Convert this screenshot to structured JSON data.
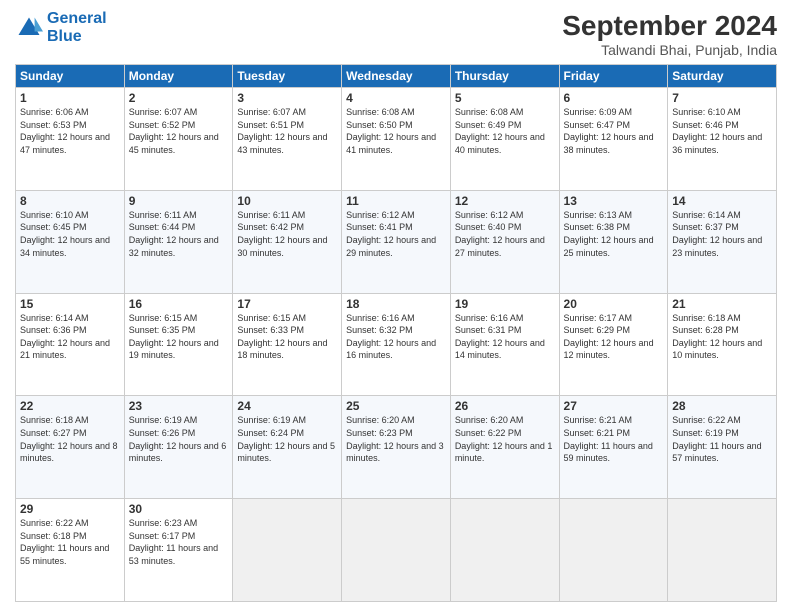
{
  "header": {
    "logo_general": "General",
    "logo_blue": "Blue",
    "month_title": "September 2024",
    "subtitle": "Talwandi Bhai, Punjab, India"
  },
  "weekdays": [
    "Sunday",
    "Monday",
    "Tuesday",
    "Wednesday",
    "Thursday",
    "Friday",
    "Saturday"
  ],
  "weeks": [
    [
      {
        "day": "1",
        "sunrise": "Sunrise: 6:06 AM",
        "sunset": "Sunset: 6:53 PM",
        "daylight": "Daylight: 12 hours and 47 minutes."
      },
      {
        "day": "2",
        "sunrise": "Sunrise: 6:07 AM",
        "sunset": "Sunset: 6:52 PM",
        "daylight": "Daylight: 12 hours and 45 minutes."
      },
      {
        "day": "3",
        "sunrise": "Sunrise: 6:07 AM",
        "sunset": "Sunset: 6:51 PM",
        "daylight": "Daylight: 12 hours and 43 minutes."
      },
      {
        "day": "4",
        "sunrise": "Sunrise: 6:08 AM",
        "sunset": "Sunset: 6:50 PM",
        "daylight": "Daylight: 12 hours and 41 minutes."
      },
      {
        "day": "5",
        "sunrise": "Sunrise: 6:08 AM",
        "sunset": "Sunset: 6:49 PM",
        "daylight": "Daylight: 12 hours and 40 minutes."
      },
      {
        "day": "6",
        "sunrise": "Sunrise: 6:09 AM",
        "sunset": "Sunset: 6:47 PM",
        "daylight": "Daylight: 12 hours and 38 minutes."
      },
      {
        "day": "7",
        "sunrise": "Sunrise: 6:10 AM",
        "sunset": "Sunset: 6:46 PM",
        "daylight": "Daylight: 12 hours and 36 minutes."
      }
    ],
    [
      {
        "day": "8",
        "sunrise": "Sunrise: 6:10 AM",
        "sunset": "Sunset: 6:45 PM",
        "daylight": "Daylight: 12 hours and 34 minutes."
      },
      {
        "day": "9",
        "sunrise": "Sunrise: 6:11 AM",
        "sunset": "Sunset: 6:44 PM",
        "daylight": "Daylight: 12 hours and 32 minutes."
      },
      {
        "day": "10",
        "sunrise": "Sunrise: 6:11 AM",
        "sunset": "Sunset: 6:42 PM",
        "daylight": "Daylight: 12 hours and 30 minutes."
      },
      {
        "day": "11",
        "sunrise": "Sunrise: 6:12 AM",
        "sunset": "Sunset: 6:41 PM",
        "daylight": "Daylight: 12 hours and 29 minutes."
      },
      {
        "day": "12",
        "sunrise": "Sunrise: 6:12 AM",
        "sunset": "Sunset: 6:40 PM",
        "daylight": "Daylight: 12 hours and 27 minutes."
      },
      {
        "day": "13",
        "sunrise": "Sunrise: 6:13 AM",
        "sunset": "Sunset: 6:38 PM",
        "daylight": "Daylight: 12 hours and 25 minutes."
      },
      {
        "day": "14",
        "sunrise": "Sunrise: 6:14 AM",
        "sunset": "Sunset: 6:37 PM",
        "daylight": "Daylight: 12 hours and 23 minutes."
      }
    ],
    [
      {
        "day": "15",
        "sunrise": "Sunrise: 6:14 AM",
        "sunset": "Sunset: 6:36 PM",
        "daylight": "Daylight: 12 hours and 21 minutes."
      },
      {
        "day": "16",
        "sunrise": "Sunrise: 6:15 AM",
        "sunset": "Sunset: 6:35 PM",
        "daylight": "Daylight: 12 hours and 19 minutes."
      },
      {
        "day": "17",
        "sunrise": "Sunrise: 6:15 AM",
        "sunset": "Sunset: 6:33 PM",
        "daylight": "Daylight: 12 hours and 18 minutes."
      },
      {
        "day": "18",
        "sunrise": "Sunrise: 6:16 AM",
        "sunset": "Sunset: 6:32 PM",
        "daylight": "Daylight: 12 hours and 16 minutes."
      },
      {
        "day": "19",
        "sunrise": "Sunrise: 6:16 AM",
        "sunset": "Sunset: 6:31 PM",
        "daylight": "Daylight: 12 hours and 14 minutes."
      },
      {
        "day": "20",
        "sunrise": "Sunrise: 6:17 AM",
        "sunset": "Sunset: 6:29 PM",
        "daylight": "Daylight: 12 hours and 12 minutes."
      },
      {
        "day": "21",
        "sunrise": "Sunrise: 6:18 AM",
        "sunset": "Sunset: 6:28 PM",
        "daylight": "Daylight: 12 hours and 10 minutes."
      }
    ],
    [
      {
        "day": "22",
        "sunrise": "Sunrise: 6:18 AM",
        "sunset": "Sunset: 6:27 PM",
        "daylight": "Daylight: 12 hours and 8 minutes."
      },
      {
        "day": "23",
        "sunrise": "Sunrise: 6:19 AM",
        "sunset": "Sunset: 6:26 PM",
        "daylight": "Daylight: 12 hours and 6 minutes."
      },
      {
        "day": "24",
        "sunrise": "Sunrise: 6:19 AM",
        "sunset": "Sunset: 6:24 PM",
        "daylight": "Daylight: 12 hours and 5 minutes."
      },
      {
        "day": "25",
        "sunrise": "Sunrise: 6:20 AM",
        "sunset": "Sunset: 6:23 PM",
        "daylight": "Daylight: 12 hours and 3 minutes."
      },
      {
        "day": "26",
        "sunrise": "Sunrise: 6:20 AM",
        "sunset": "Sunset: 6:22 PM",
        "daylight": "Daylight: 12 hours and 1 minute."
      },
      {
        "day": "27",
        "sunrise": "Sunrise: 6:21 AM",
        "sunset": "Sunset: 6:21 PM",
        "daylight": "Daylight: 11 hours and 59 minutes."
      },
      {
        "day": "28",
        "sunrise": "Sunrise: 6:22 AM",
        "sunset": "Sunset: 6:19 PM",
        "daylight": "Daylight: 11 hours and 57 minutes."
      }
    ],
    [
      {
        "day": "29",
        "sunrise": "Sunrise: 6:22 AM",
        "sunset": "Sunset: 6:18 PM",
        "daylight": "Daylight: 11 hours and 55 minutes."
      },
      {
        "day": "30",
        "sunrise": "Sunrise: 6:23 AM",
        "sunset": "Sunset: 6:17 PM",
        "daylight": "Daylight: 11 hours and 53 minutes."
      },
      null,
      null,
      null,
      null,
      null
    ]
  ]
}
